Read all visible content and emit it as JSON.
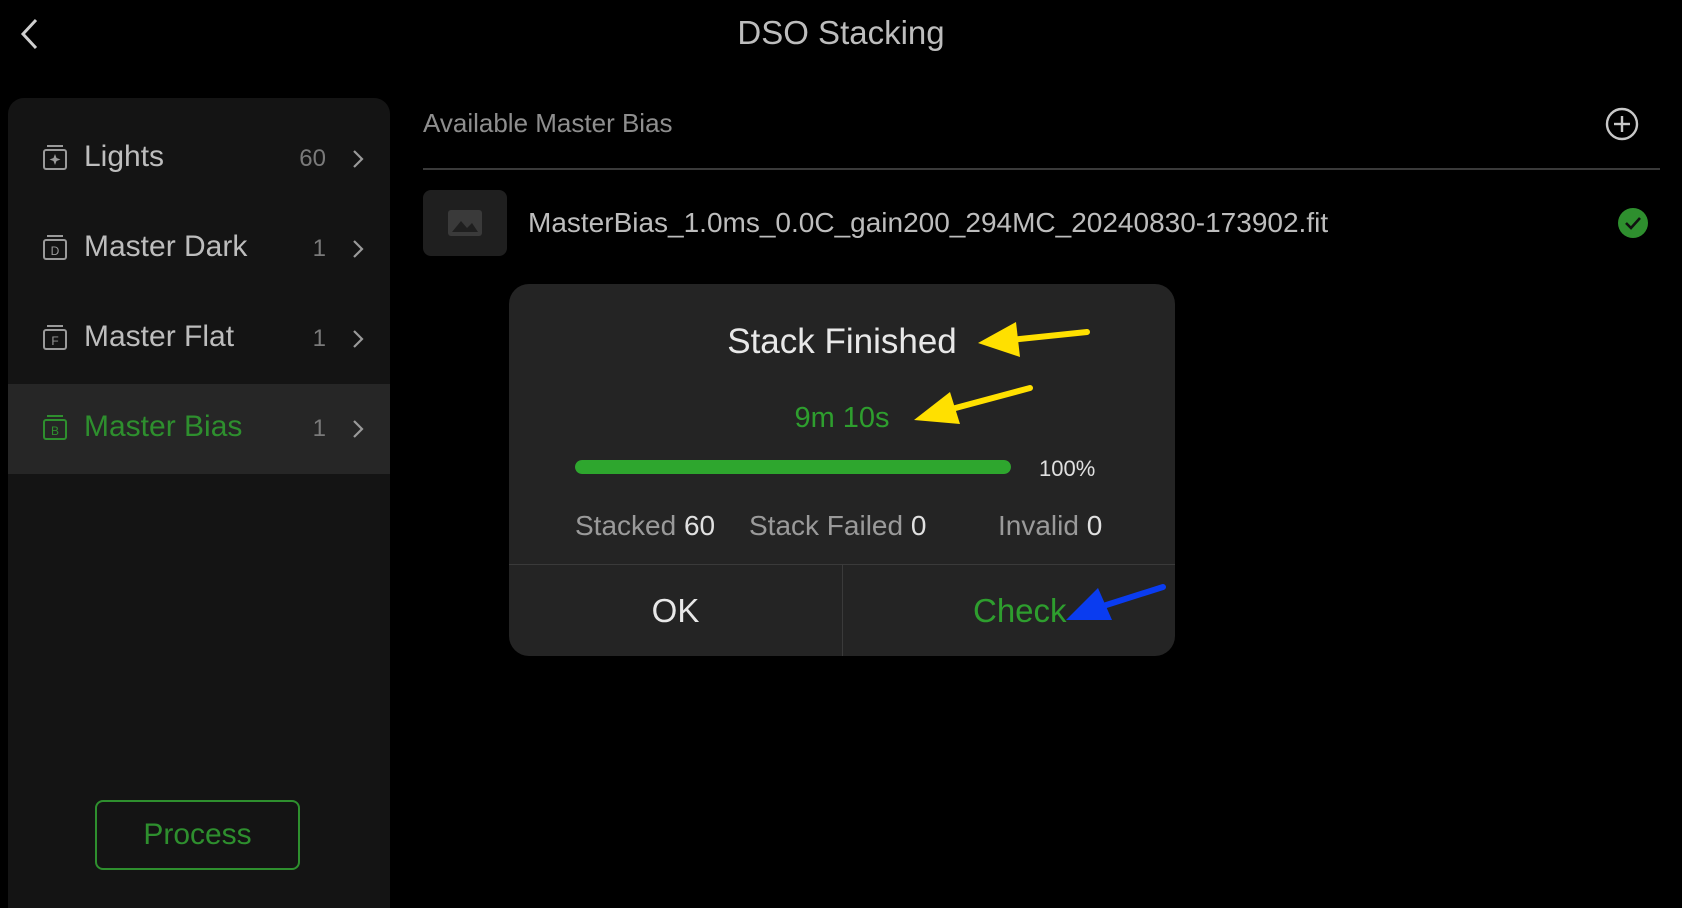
{
  "header": {
    "title": "DSO Stacking"
  },
  "sidebar": {
    "items": [
      {
        "label": "Lights",
        "count": "60",
        "icon_letter": "",
        "active": false
      },
      {
        "label": "Master Dark",
        "count": "1",
        "icon_letter": "D",
        "active": false
      },
      {
        "label": "Master Flat",
        "count": "1",
        "icon_letter": "F",
        "active": false
      },
      {
        "label": "Master Bias",
        "count": "1",
        "icon_letter": "B",
        "active": true
      }
    ],
    "process_label": "Process"
  },
  "main": {
    "header": "Available Master Bias",
    "files": [
      {
        "name": "MasterBias_1.0ms_0.0C_gain200_294MC_20240830-173902.fit",
        "selected": true
      }
    ]
  },
  "dialog": {
    "title": "Stack Finished",
    "elapsed": "9m 10s",
    "progress": 100,
    "progress_label": "100%",
    "stats": {
      "stacked_label": "Stacked",
      "stacked_value": "60",
      "failed_label": "Stack Failed",
      "failed_value": "0",
      "invalid_label": "Invalid",
      "invalid_value": "0"
    },
    "ok_label": "OK",
    "check_label": "Check"
  },
  "icons": {
    "back": "chevron-left-icon",
    "add": "plus-circle-icon",
    "selected": "check-circle-icon",
    "file_thumb": "image-icon"
  },
  "colors": {
    "accent_green": "#2e9e2e",
    "annotation_yellow": "#ffe000",
    "annotation_blue": "#0a3cf0"
  }
}
